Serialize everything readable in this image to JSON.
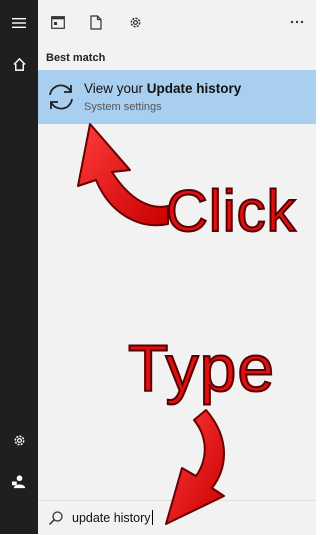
{
  "nav": {
    "items": [
      {
        "name": "menu-icon",
        "icon": "hamburger"
      },
      {
        "name": "home-icon",
        "icon": "home"
      },
      {
        "name": "settings-icon",
        "icon": "gear"
      },
      {
        "name": "feedback-icon",
        "icon": "person-feedback"
      }
    ]
  },
  "toolbar": {
    "items": [
      {
        "name": "apps-tab-icon",
        "icon": "window"
      },
      {
        "name": "documents-tab-icon",
        "icon": "document"
      },
      {
        "name": "settings-tab-icon",
        "icon": "gear"
      },
      {
        "name": "more-options-icon",
        "icon": "ellipsis"
      }
    ]
  },
  "results": {
    "section_title": "Best match",
    "best_match": {
      "title_prefix": "View your ",
      "title_bold": "Update history",
      "subtitle": "System settings",
      "icon": "sync-arrows"
    }
  },
  "search": {
    "value": "update history"
  },
  "annotations": {
    "click_label": "Click",
    "type_label": "Type",
    "color": "#e01010"
  },
  "colors": {
    "rail_bg": "#1f1f1f",
    "panel_bg": "#f2f2f2",
    "selected_bg": "#a9cff0"
  }
}
